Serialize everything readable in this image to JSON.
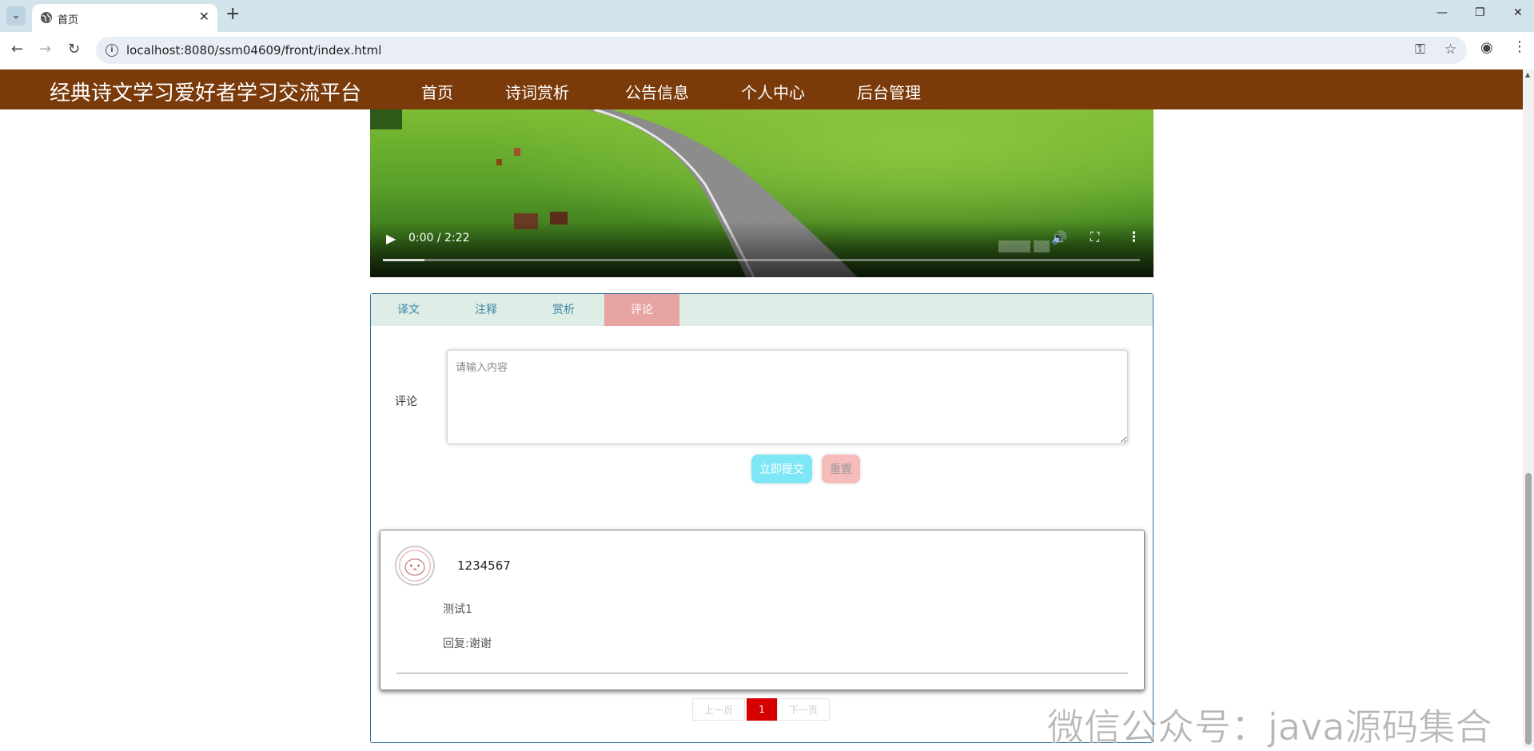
{
  "browser": {
    "tab_title": "首页",
    "new_tab_symbol": "+",
    "close_symbol": "✕",
    "url": "localhost:8080/ssm04609/front/index.html"
  },
  "site": {
    "title": "经典诗文学习爱好者学习交流平台",
    "nav": [
      "首页",
      "诗词赏析",
      "公告信息",
      "个人中心",
      "后台管理"
    ],
    "header_color": "#7a3a0a"
  },
  "video": {
    "time": "0:00 / 2:22",
    "progress_fraction": 0.055
  },
  "tabs": {
    "items": [
      "译文",
      "注释",
      "赏析",
      "评论"
    ],
    "active": "评论"
  },
  "comment_form": {
    "label": "评论",
    "placeholder": "请输入内容",
    "value": "",
    "submit_label": "立即提交",
    "reset_label": "重置"
  },
  "comments": [
    {
      "username": "1234567",
      "text": "测试1",
      "reply": "回复:谢谢"
    }
  ],
  "pagination": {
    "prev_label": "上一页",
    "current": "1",
    "next_label": "下一页",
    "current_color": "#d60000"
  },
  "watermark": "微信公众号：java源码集合"
}
